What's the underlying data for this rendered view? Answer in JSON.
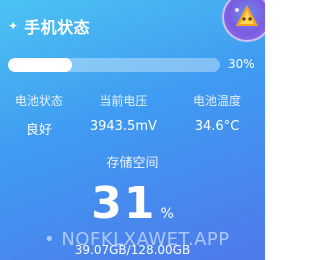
{
  "header": {
    "sparkle_icon": "sparkle-icon",
    "title": "手机状态",
    "avatar_icon": "avatar-icon"
  },
  "battery": {
    "level_fraction": 0.3,
    "percent_label": "30%"
  },
  "stats": [
    {
      "label": "电池状态",
      "value": "良好"
    },
    {
      "label": "当前电压",
      "value": "3943.5mV"
    },
    {
      "label": "电池温度",
      "value": "34.6°C"
    }
  ],
  "storage": {
    "label": "存储空间",
    "percent": "31",
    "percent_symbol": "%",
    "detail": "39.07GB/128.00GB"
  },
  "watermark": "• NOFKLXAWET.APP",
  "colors": {
    "gradient_start": "#4cc3f2",
    "gradient_end": "#4f79ea",
    "text": "#ffffff"
  }
}
